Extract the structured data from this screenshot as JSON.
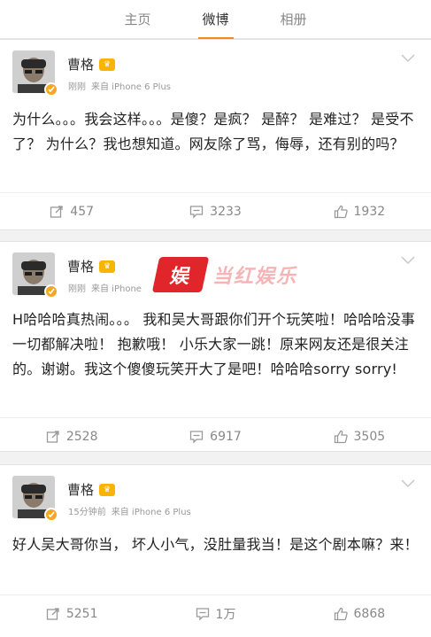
{
  "tabs": [
    {
      "label": "主页",
      "active": false
    },
    {
      "label": "微博",
      "active": true
    },
    {
      "label": "相册",
      "active": false
    }
  ],
  "accent_color": "#f08b24",
  "posts": [
    {
      "username": "曹格",
      "time": "刚刚",
      "source": "来自 iPhone 6 Plus",
      "text": "为什么。。。我会这样。。。是傻？是疯？ 是醉？ 是难过？ 是受不了？ 为什么？我也想知道。网友除了骂，侮辱，还有别的吗？",
      "reposts": "457",
      "comments": "3233",
      "likes": "1932"
    },
    {
      "username": "曹格",
      "time": "刚刚",
      "source": "来自 iPhone",
      "text": "H哈哈哈真热闹。。。 我和吴大哥跟你们开个玩笑啦！哈哈哈没事 一切都解决啦！ 抱歉哦！ 小乐大家一跳！原来网友还是很关注的。谢谢。我这个傻傻玩笑开大了是吧！哈哈哈sorry sorry!",
      "reposts": "2528",
      "comments": "6917",
      "likes": "3505"
    },
    {
      "username": "曹格",
      "time": "15分钟前",
      "source": "来自 iPhone 6 Plus",
      "text": "好人吴大哥你当， 坏人小气，没肚量我当！是这个剧本嘛？来！",
      "reposts": "5251",
      "comments": "1万",
      "likes": "6868"
    }
  ],
  "watermark": {
    "text": "当红娱乐"
  },
  "icons": {
    "repost": "repost-icon",
    "comment": "comment-icon",
    "like": "like-icon",
    "menu": "chevron-down-icon",
    "verified": "verified-badge-icon",
    "vip": "vip-crown-icon"
  }
}
